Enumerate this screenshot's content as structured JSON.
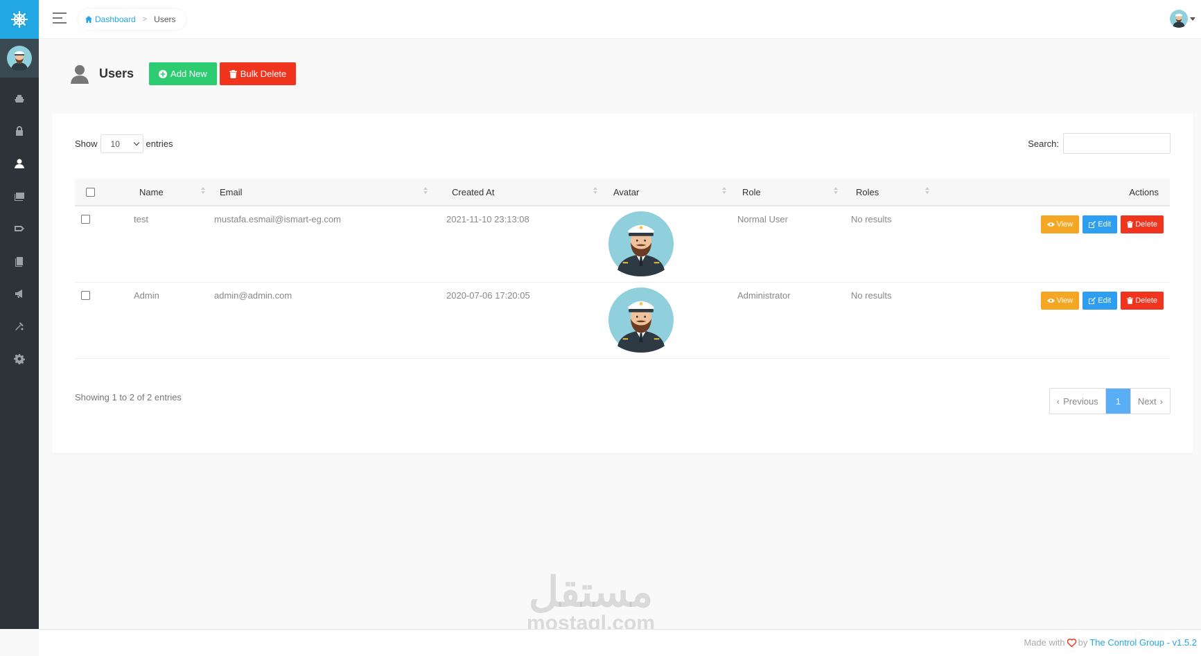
{
  "breadcrumb": {
    "home": "Dashboard",
    "current": "Users"
  },
  "page": {
    "title": "Users",
    "add_label": "Add New",
    "bulk_delete_label": "Bulk Delete"
  },
  "table_controls": {
    "show_label": "Show",
    "entries_value": "10",
    "entries_label": "entries",
    "search_label": "Search:"
  },
  "table": {
    "columns": [
      "Name",
      "Email",
      "Created At",
      "Avatar",
      "Role",
      "Roles",
      "Actions"
    ],
    "rows": [
      {
        "name": "test",
        "email": "mustafa.esmail@ismart-eg.com",
        "created_at": "2021-11-10 23:13:08",
        "role": "Normal User",
        "roles": "No results"
      },
      {
        "name": "Admin",
        "email": "admin@admin.com",
        "created_at": "2020-07-06 17:20:05",
        "role": "Administrator",
        "roles": "No results"
      }
    ],
    "actions": {
      "view": "View",
      "edit": "Edit",
      "delete": "Delete"
    }
  },
  "pagination": {
    "info": "Showing 1 to 2 of 2 entries",
    "previous": "Previous",
    "page": "1",
    "next": "Next"
  },
  "watermark": {
    "arabic": "مستقل",
    "latin": "mostaql.com"
  },
  "footer": {
    "made_with": "Made with",
    "by": "by",
    "company": "The Control Group - v1.5.2"
  },
  "colors": {
    "brand": "#22a7e2",
    "sidebar": "#2d3338",
    "success": "#2ecc71",
    "danger": "#f0341e",
    "warning": "#f5a623",
    "info": "#2e9ef0"
  },
  "icons": [
    "ship-wheel-icon",
    "menu-icon",
    "home-icon",
    "user-icon",
    "plus-circle-icon",
    "trash-icon",
    "eye-icon",
    "edit-icon",
    "ship-icon",
    "lock-icon",
    "images-icon",
    "tag-icon",
    "copy-icon",
    "bullhorn-icon",
    "tools-icon",
    "gear-icon",
    "heart-icon"
  ]
}
